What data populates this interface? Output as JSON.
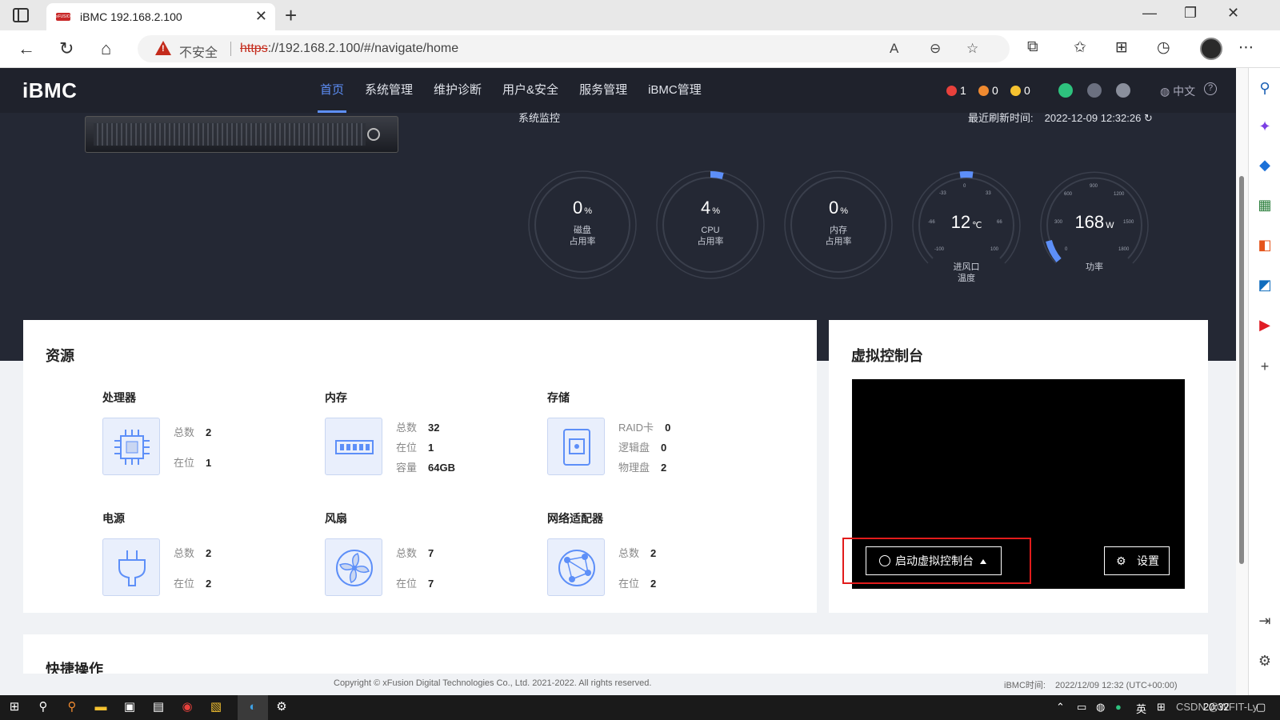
{
  "browser": {
    "tab_title": "iBMC 192.168.2.100",
    "tab_favicon_text": "xFUSION",
    "insecure_label": "不安全",
    "url_scheme": "https",
    "url_rest": "://192.168.2.100/#/navigate/home"
  },
  "header": {
    "logo": "iBMC",
    "menu": [
      "首页",
      "系统管理",
      "维护诊断",
      "用户&安全",
      "服务管理",
      "iBMC管理"
    ],
    "alarms": {
      "critical": "1",
      "major": "0",
      "minor": "0"
    },
    "language": "中文",
    "help": "?"
  },
  "monitor": {
    "title": "系统监控",
    "refresh_label": "最近刷新时间:",
    "refresh_time": "2022-12-09 12:32:26"
  },
  "gauges": {
    "disk": {
      "value": "0",
      "unit": "%",
      "label1": "磁盘",
      "label2": "占用率",
      "fraction": 0
    },
    "cpu": {
      "value": "4",
      "unit": "%",
      "label1": "CPU",
      "label2": "占用率",
      "fraction": 0.04
    },
    "mem": {
      "value": "0",
      "unit": "%",
      "label1": "内存",
      "label2": "占用率",
      "fraction": 0
    },
    "temp": {
      "value": "12",
      "unit": "℃",
      "label1": "进风口",
      "label2": "温度",
      "ticks": [
        "-100",
        "-66",
        "-33",
        "0",
        "33",
        "66",
        "100"
      ]
    },
    "power": {
      "value": "168",
      "unit": "W",
      "label1": "功率",
      "ticks": [
        "0",
        "300",
        "600",
        "900",
        "1200",
        "1500",
        "1800"
      ]
    }
  },
  "resources": {
    "title": "资源",
    "cpu": {
      "title": "处理器",
      "total_label": "总数",
      "total": "2",
      "present_label": "在位",
      "present": "1"
    },
    "memory": {
      "title": "内存",
      "total_label": "总数",
      "total": "32",
      "present_label": "在位",
      "present": "1",
      "capacity_label": "容量",
      "capacity": "64GB"
    },
    "storage": {
      "title": "存储",
      "raid_label": "RAID卡",
      "raid": "0",
      "logical_label": "逻辑盘",
      "logical": "0",
      "physical_label": "物理盘",
      "physical": "2"
    },
    "power": {
      "title": "电源",
      "total_label": "总数",
      "total": "2",
      "present_label": "在位",
      "present": "2"
    },
    "fan": {
      "title": "风扇",
      "total_label": "总数",
      "total": "7",
      "present_label": "在位",
      "present": "7"
    },
    "network": {
      "title": "网络适配器",
      "total_label": "总数",
      "total": "2",
      "present_label": "在位",
      "present": "2"
    }
  },
  "kvm": {
    "title": "虚拟控制台",
    "launch_label": "启动虚拟控制台",
    "settings_label": "设置"
  },
  "quick": {
    "title": "快捷操作"
  },
  "footer": {
    "copyright": "Copyright © xFusion Digital Technologies Co., Ltd. 2021-2022. All rights reserved.",
    "time_label": "iBMC时间:",
    "time_value": "2022/12/09 12:32 (UTC+00:00)"
  },
  "taskbar": {
    "ime": "英",
    "clock": "20:32",
    "watermark": "CSDN @WFIT-Ly"
  },
  "colors": {
    "accent": "#5d8ff8",
    "dark_bg": "#242834",
    "critical": "#e8413c",
    "major": "#f08a30",
    "minor": "#f5c230"
  }
}
